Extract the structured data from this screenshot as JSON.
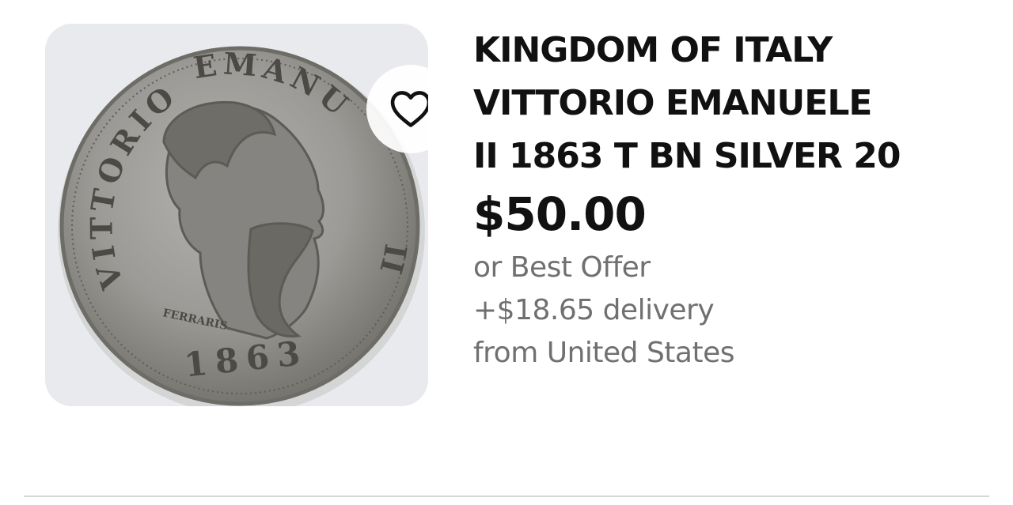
{
  "listing": {
    "title_lines": [
      "KINGDOM OF ITALY",
      "VITTORIO EMANUELE",
      "II 1863 T BN SILVER 20"
    ],
    "price": "$50.00",
    "offer": "or Best Offer",
    "delivery": "+$18.65 delivery",
    "origin": "from United States",
    "image": {
      "subject": "silver coin, profile portrait",
      "coin_legend_left": "VITTORIO",
      "coin_legend_right": "EMANUELE II",
      "coin_year": "1863",
      "coin_engraver": "FERRARIS"
    },
    "watch_icon": "heart-outline-icon"
  },
  "colors": {
    "title": "#111111",
    "price": "#111111",
    "secondary_text": "#707070",
    "thumb_bg": "#e9eaee",
    "coin_silver": "#9b9a96",
    "divider": "#d6d6d6"
  }
}
